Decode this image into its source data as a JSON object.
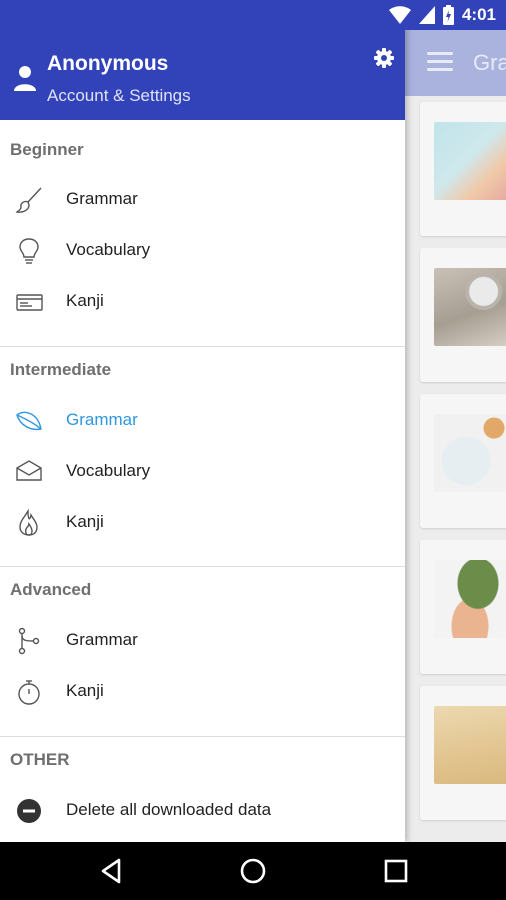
{
  "status_bar": {
    "time": "4:01"
  },
  "app": {
    "title": "Gra"
  },
  "drawer": {
    "user_name": "Anonymous",
    "account_link": "Account & Settings",
    "sections": {
      "beginner": {
        "title": "Beginner",
        "items": [
          {
            "label": "Grammar",
            "icon": "brush-icon"
          },
          {
            "label": "Vocabulary",
            "icon": "lightbulb-icon"
          },
          {
            "label": "Kanji",
            "icon": "card-icon"
          }
        ]
      },
      "intermediate": {
        "title": "Intermediate",
        "items": [
          {
            "label": "Grammar",
            "icon": "leaf-icon",
            "active": true
          },
          {
            "label": "Vocabulary",
            "icon": "envelope-icon"
          },
          {
            "label": "Kanji",
            "icon": "flame-icon"
          }
        ]
      },
      "advanced": {
        "title": "Advanced",
        "items": [
          {
            "label": "Grammar",
            "icon": "branch-icon"
          },
          {
            "label": "Kanji",
            "icon": "stopwatch-icon"
          }
        ]
      },
      "other": {
        "title": "OTHER",
        "items": [
          {
            "label": "Delete all downloaded data",
            "icon": "minus-circle-icon"
          }
        ]
      }
    }
  },
  "colors": {
    "primary": "#3242b8",
    "accent": "#2f97e0",
    "toolbar_dim": "#a9b3de"
  }
}
